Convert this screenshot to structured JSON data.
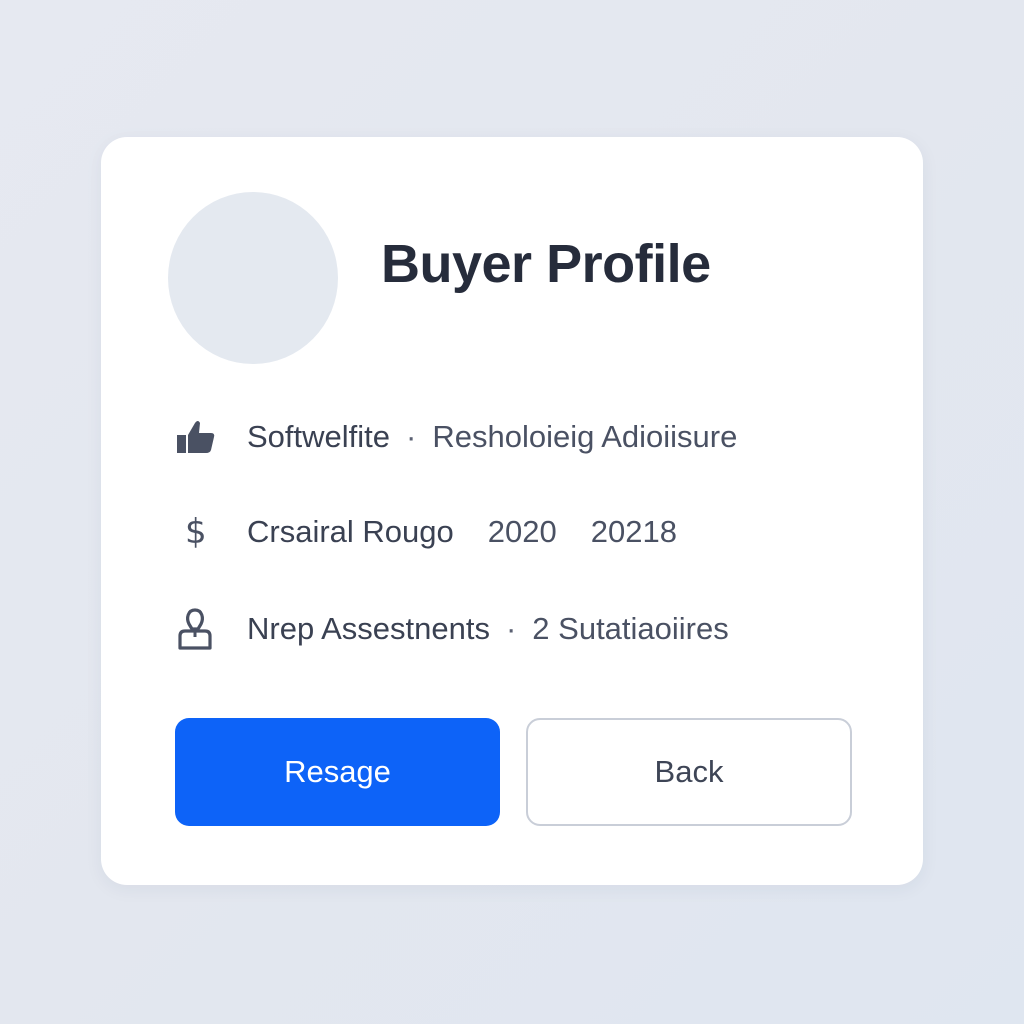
{
  "profile": {
    "title": "Buyer Profile"
  },
  "rows": [
    {
      "icon": "thumbs-up-icon",
      "label": "Softwelfite",
      "separator": "·",
      "value": "Resholoieig Adioiisure"
    },
    {
      "icon": "dollar-icon",
      "icon_glyph": "$",
      "label": "Crsairal Rougo",
      "value_a": "2020",
      "value_b": "20218"
    },
    {
      "icon": "user-badge-icon",
      "label": "Nrep Assestnents",
      "separator": "·",
      "value": "2 Sutatiaoiires"
    }
  ],
  "actions": {
    "primary_label": "Resage",
    "secondary_label": "Back"
  },
  "colors": {
    "primary": "#0d63f8",
    "title": "#262c3b",
    "text": "#4a5163",
    "avatar": "#e4e9f0",
    "border": "#c9ced8"
  }
}
